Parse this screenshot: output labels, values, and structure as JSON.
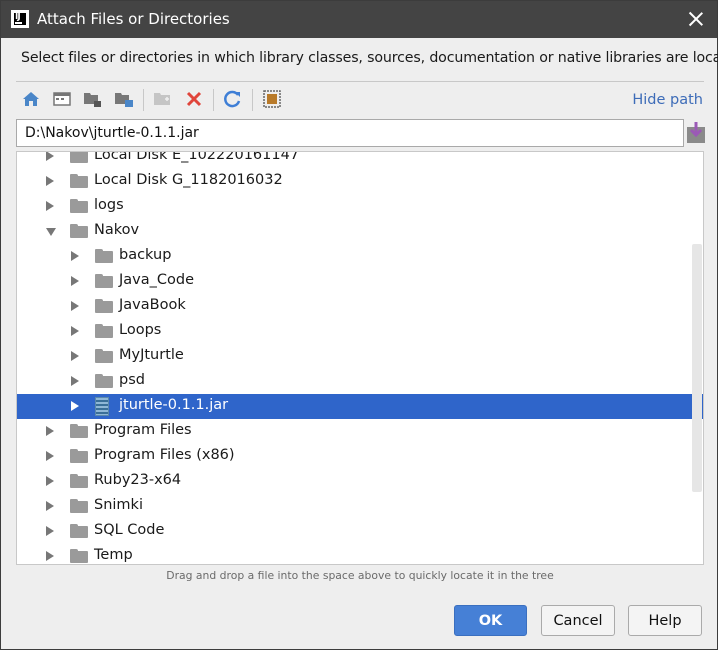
{
  "window": {
    "title": "Attach Files or Directories",
    "description": "Select files or directories in which library classes, sources, documentation or native libraries are located"
  },
  "toolbar": {
    "icons": [
      "home-icon",
      "desktop-icon",
      "project-icon",
      "module-icon",
      "new-folder-icon",
      "delete-icon",
      "refresh-icon",
      "show-hidden-icon"
    ],
    "hide_path_label": "Hide path"
  },
  "path": {
    "value": "D:\\Nakov\\jturtle-0.1.1.jar"
  },
  "tree": {
    "rows": [
      {
        "label": "Local Disk E_102220161147",
        "level": 0,
        "type": "folder",
        "expanded": false
      },
      {
        "label": "Local Disk G_1182016032",
        "level": 0,
        "type": "folder",
        "expanded": false
      },
      {
        "label": "logs",
        "level": 0,
        "type": "folder",
        "expanded": false
      },
      {
        "label": "Nakov",
        "level": 0,
        "type": "folder",
        "expanded": true
      },
      {
        "label": "backup",
        "level": 1,
        "type": "folder",
        "expanded": false
      },
      {
        "label": "Java_Code",
        "level": 1,
        "type": "folder",
        "expanded": false
      },
      {
        "label": "JavaBook",
        "level": 1,
        "type": "folder",
        "expanded": false
      },
      {
        "label": "Loops",
        "level": 1,
        "type": "folder",
        "expanded": false
      },
      {
        "label": "MyJturtle",
        "level": 1,
        "type": "folder",
        "expanded": false
      },
      {
        "label": "psd",
        "level": 1,
        "type": "folder",
        "expanded": false
      },
      {
        "label": "jturtle-0.1.1.jar",
        "level": 1,
        "type": "jar",
        "expanded": false,
        "selected": true
      },
      {
        "label": "Program Files",
        "level": 0,
        "type": "folder",
        "expanded": false
      },
      {
        "label": "Program Files (x86)",
        "level": 0,
        "type": "folder",
        "expanded": false
      },
      {
        "label": "Ruby23-x64",
        "level": 0,
        "type": "folder",
        "expanded": false
      },
      {
        "label": "Snimki",
        "level": 0,
        "type": "folder",
        "expanded": false
      },
      {
        "label": "SQL Code",
        "level": 0,
        "type": "folder",
        "expanded": false
      },
      {
        "label": "Temp",
        "level": 0,
        "type": "folder",
        "expanded": false
      }
    ]
  },
  "hint": "Drag and drop a file into the space above to quickly locate it in the tree",
  "buttons": {
    "ok": "OK",
    "cancel": "Cancel",
    "help": "Help"
  },
  "colors": {
    "selection": "#2f65ca",
    "ok_button": "#4680d6",
    "link": "#3d6cb8"
  }
}
